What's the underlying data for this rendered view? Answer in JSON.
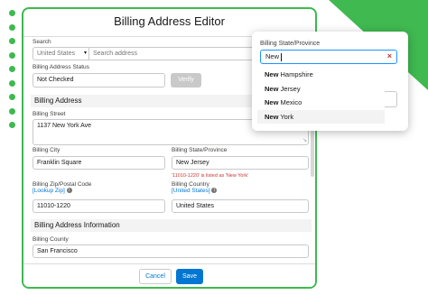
{
  "modal": {
    "title": "Billing Address Editor"
  },
  "search": {
    "label": "Search",
    "country_value": "United States",
    "placeholder": "Search address"
  },
  "status": {
    "label": "Billing Address Status",
    "value": "Not Checked"
  },
  "verify_button": "Verify",
  "billing_section": "Billing Address",
  "street": {
    "label": "Billing Street",
    "value": "1137 New York Ave"
  },
  "city": {
    "label": "Billing City",
    "value": "Franklin Square"
  },
  "state": {
    "label": "Billing State/Province",
    "value": "New Jersey",
    "warning": "'11010-1220' is listed as 'New York'"
  },
  "zip": {
    "label": "Billing Zip/Postal Code",
    "lookup": "[Lookup Zip]",
    "value": "11010-1220"
  },
  "country": {
    "label": "Billing Country",
    "link": "[United States]",
    "value": "United States"
  },
  "info_section": "Billing Address Information",
  "county": {
    "label": "Billing County",
    "value": "San Francisco"
  },
  "footer": {
    "cancel": "Cancel",
    "save": "Save"
  },
  "popup": {
    "label": "Billing State/Province",
    "query": "New",
    "options": [
      {
        "match": "New",
        "rest": " Hampshire"
      },
      {
        "match": "New",
        "rest": " Jersey"
      },
      {
        "match": "New",
        "rest": " Mexico"
      },
      {
        "match": "New",
        "rest": " York"
      }
    ],
    "active_index": 3
  },
  "icons": {
    "info": "info-icon",
    "clear": "clear-icon",
    "chevron": "chevron-down-icon",
    "resize": "resize-handle-icon"
  },
  "colors": {
    "accent_green": "#3fb950",
    "brand_blue": "#0176d3",
    "error_red": "#c23934"
  }
}
